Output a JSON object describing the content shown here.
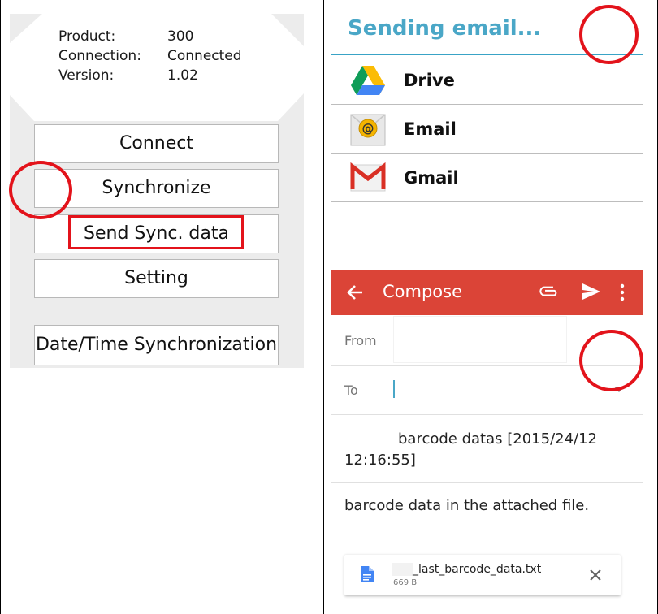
{
  "left": {
    "info": [
      {
        "key": "Product:",
        "value": "300"
      },
      {
        "key": "Connection:",
        "value": "Connected"
      },
      {
        "key": "Version:",
        "value": "1.02"
      }
    ],
    "buttons": {
      "connect": "Connect",
      "synchronize": "Synchronize",
      "send_sync": "Send Sync. data",
      "setting": "Setting",
      "datetime_sync": "Date/Time Synchronization"
    }
  },
  "share": {
    "title": "Sending email...",
    "apps": [
      {
        "label": "Drive",
        "icon": "google-drive-icon"
      },
      {
        "label": "Email",
        "icon": "email-at-icon"
      },
      {
        "label": "Gmail",
        "icon": "gmail-icon"
      }
    ]
  },
  "compose": {
    "title": "Compose",
    "from_label": "From",
    "to_label": "To",
    "subject": "barcode datas [2015/24/12 12:16:55]",
    "body": "barcode data in the attached file.",
    "attachment_name": "_last_barcode_data.txt",
    "attachment_size": "669 B"
  },
  "colors": {
    "annotation_red": "#e3131b",
    "share_title": "#4aa7c7",
    "gmail_appbar": "#db4437"
  }
}
